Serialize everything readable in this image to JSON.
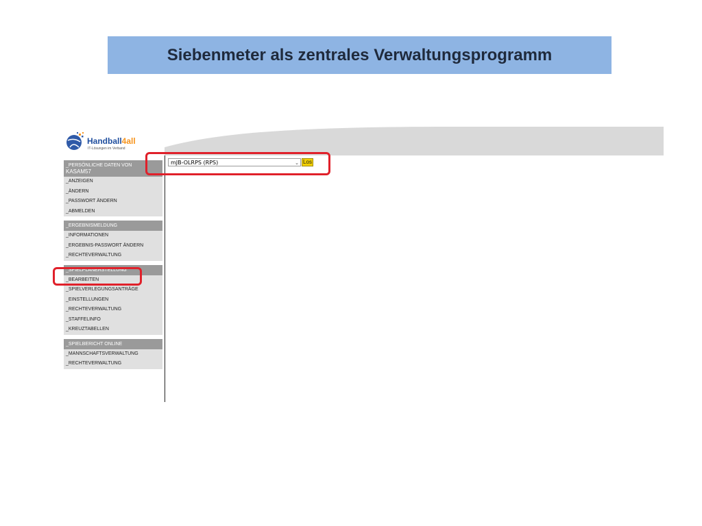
{
  "slide": {
    "title": "Siebenmeter als zentrales Verwaltungsprogramm"
  },
  "logo": {
    "name_main": "Handball",
    "name_accent": "4all",
    "tagline": "IT-Lösungen im Verband",
    "icon": "handball-logo-icon"
  },
  "sidebar": {
    "groups": [
      {
        "header": "_PERSÖNLICHE DATEN VON",
        "user": "kasam57",
        "items": [
          "_ANZEIGEN",
          "_ÄNDERN",
          "_PASSWORT ÄNDERN",
          "_ABMELDEN"
        ]
      },
      {
        "header": "_ERGEBNISMELDUNG",
        "items": [
          "_INFORMATIONEN",
          "_ERGEBNIS-PASSWORT ÄNDERN",
          "_RECHTEVERWALTUNG"
        ]
      },
      {
        "header": "_SPIELPLANERSTELLUNG",
        "items": [
          "_BEARBEITEN",
          "_SPIELVERLEGUNGSANTRÄGE",
          "_EINSTELLUNGEN",
          "_RECHTEVERWALTUNG",
          "_STAFFELINFO",
          "_KREUZTABELLEN"
        ]
      },
      {
        "header": "_SPIELBERICHT ONLINE",
        "items": [
          "_MANNSCHAFTSVERWALTUNG",
          "_RECHTEVERWALTUNG"
        ]
      }
    ]
  },
  "main": {
    "staffel_select": {
      "value": "mJB-OLRPS (RPS)"
    },
    "go_button": "Los"
  },
  "colors": {
    "banner": "#8eb4e3",
    "highlight": "#e0202a",
    "sidebar_header": "#9a9a9a",
    "sidebar_bg": "#e0e0e0",
    "go_button": "#f2d000"
  }
}
